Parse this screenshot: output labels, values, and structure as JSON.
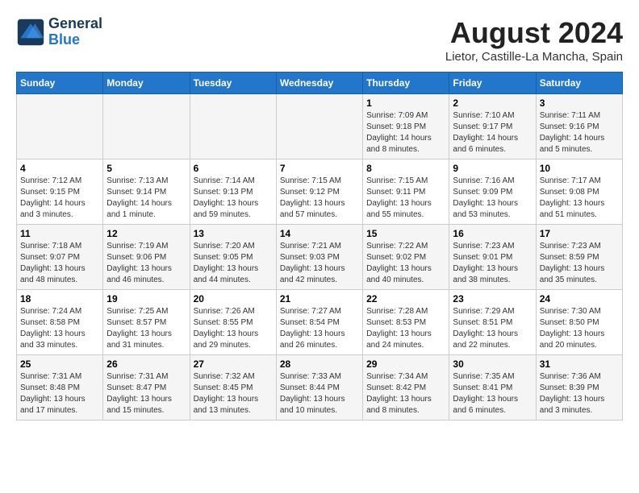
{
  "header": {
    "logo_line1": "General",
    "logo_line2": "Blue",
    "month_year": "August 2024",
    "location": "Lietor, Castille-La Mancha, Spain"
  },
  "days_of_week": [
    "Sunday",
    "Monday",
    "Tuesday",
    "Wednesday",
    "Thursday",
    "Friday",
    "Saturday"
  ],
  "weeks": [
    [
      {
        "day": "",
        "info": ""
      },
      {
        "day": "",
        "info": ""
      },
      {
        "day": "",
        "info": ""
      },
      {
        "day": "",
        "info": ""
      },
      {
        "day": "1",
        "info": "Sunrise: 7:09 AM\nSunset: 9:18 PM\nDaylight: 14 hours\nand 8 minutes."
      },
      {
        "day": "2",
        "info": "Sunrise: 7:10 AM\nSunset: 9:17 PM\nDaylight: 14 hours\nand 6 minutes."
      },
      {
        "day": "3",
        "info": "Sunrise: 7:11 AM\nSunset: 9:16 PM\nDaylight: 14 hours\nand 5 minutes."
      }
    ],
    [
      {
        "day": "4",
        "info": "Sunrise: 7:12 AM\nSunset: 9:15 PM\nDaylight: 14 hours\nand 3 minutes."
      },
      {
        "day": "5",
        "info": "Sunrise: 7:13 AM\nSunset: 9:14 PM\nDaylight: 14 hours\nand 1 minute."
      },
      {
        "day": "6",
        "info": "Sunrise: 7:14 AM\nSunset: 9:13 PM\nDaylight: 13 hours\nand 59 minutes."
      },
      {
        "day": "7",
        "info": "Sunrise: 7:15 AM\nSunset: 9:12 PM\nDaylight: 13 hours\nand 57 minutes."
      },
      {
        "day": "8",
        "info": "Sunrise: 7:15 AM\nSunset: 9:11 PM\nDaylight: 13 hours\nand 55 minutes."
      },
      {
        "day": "9",
        "info": "Sunrise: 7:16 AM\nSunset: 9:09 PM\nDaylight: 13 hours\nand 53 minutes."
      },
      {
        "day": "10",
        "info": "Sunrise: 7:17 AM\nSunset: 9:08 PM\nDaylight: 13 hours\nand 51 minutes."
      }
    ],
    [
      {
        "day": "11",
        "info": "Sunrise: 7:18 AM\nSunset: 9:07 PM\nDaylight: 13 hours\nand 48 minutes."
      },
      {
        "day": "12",
        "info": "Sunrise: 7:19 AM\nSunset: 9:06 PM\nDaylight: 13 hours\nand 46 minutes."
      },
      {
        "day": "13",
        "info": "Sunrise: 7:20 AM\nSunset: 9:05 PM\nDaylight: 13 hours\nand 44 minutes."
      },
      {
        "day": "14",
        "info": "Sunrise: 7:21 AM\nSunset: 9:03 PM\nDaylight: 13 hours\nand 42 minutes."
      },
      {
        "day": "15",
        "info": "Sunrise: 7:22 AM\nSunset: 9:02 PM\nDaylight: 13 hours\nand 40 minutes."
      },
      {
        "day": "16",
        "info": "Sunrise: 7:23 AM\nSunset: 9:01 PM\nDaylight: 13 hours\nand 38 minutes."
      },
      {
        "day": "17",
        "info": "Sunrise: 7:23 AM\nSunset: 8:59 PM\nDaylight: 13 hours\nand 35 minutes."
      }
    ],
    [
      {
        "day": "18",
        "info": "Sunrise: 7:24 AM\nSunset: 8:58 PM\nDaylight: 13 hours\nand 33 minutes."
      },
      {
        "day": "19",
        "info": "Sunrise: 7:25 AM\nSunset: 8:57 PM\nDaylight: 13 hours\nand 31 minutes."
      },
      {
        "day": "20",
        "info": "Sunrise: 7:26 AM\nSunset: 8:55 PM\nDaylight: 13 hours\nand 29 minutes."
      },
      {
        "day": "21",
        "info": "Sunrise: 7:27 AM\nSunset: 8:54 PM\nDaylight: 13 hours\nand 26 minutes."
      },
      {
        "day": "22",
        "info": "Sunrise: 7:28 AM\nSunset: 8:53 PM\nDaylight: 13 hours\nand 24 minutes."
      },
      {
        "day": "23",
        "info": "Sunrise: 7:29 AM\nSunset: 8:51 PM\nDaylight: 13 hours\nand 22 minutes."
      },
      {
        "day": "24",
        "info": "Sunrise: 7:30 AM\nSunset: 8:50 PM\nDaylight: 13 hours\nand 20 minutes."
      }
    ],
    [
      {
        "day": "25",
        "info": "Sunrise: 7:31 AM\nSunset: 8:48 PM\nDaylight: 13 hours\nand 17 minutes."
      },
      {
        "day": "26",
        "info": "Sunrise: 7:31 AM\nSunset: 8:47 PM\nDaylight: 13 hours\nand 15 minutes."
      },
      {
        "day": "27",
        "info": "Sunrise: 7:32 AM\nSunset: 8:45 PM\nDaylight: 13 hours\nand 13 minutes."
      },
      {
        "day": "28",
        "info": "Sunrise: 7:33 AM\nSunset: 8:44 PM\nDaylight: 13 hours\nand 10 minutes."
      },
      {
        "day": "29",
        "info": "Sunrise: 7:34 AM\nSunset: 8:42 PM\nDaylight: 13 hours\nand 8 minutes."
      },
      {
        "day": "30",
        "info": "Sunrise: 7:35 AM\nSunset: 8:41 PM\nDaylight: 13 hours\nand 6 minutes."
      },
      {
        "day": "31",
        "info": "Sunrise: 7:36 AM\nSunset: 8:39 PM\nDaylight: 13 hours\nand 3 minutes."
      }
    ]
  ]
}
